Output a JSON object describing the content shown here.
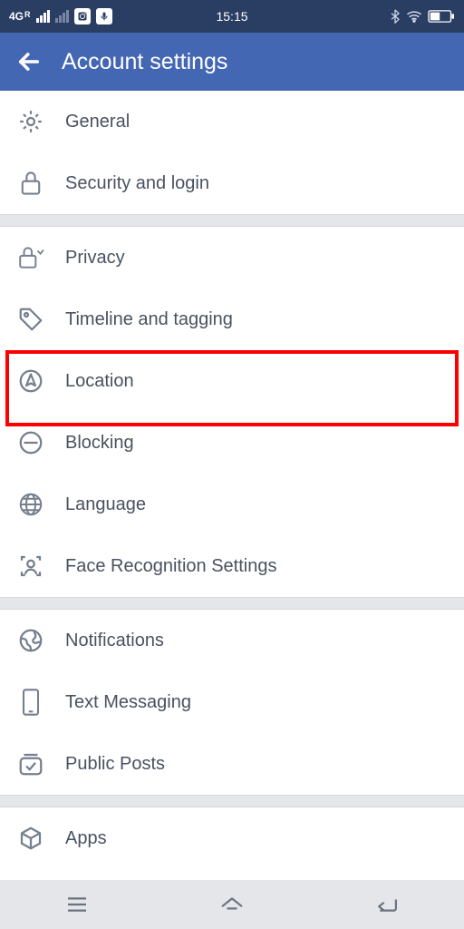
{
  "status": {
    "network_label": "4G",
    "network_sup": "R",
    "time": "15:15"
  },
  "header": {
    "title": "Account settings"
  },
  "sections": [
    {
      "items": [
        {
          "id": "general",
          "icon": "gear-icon",
          "label": "General"
        },
        {
          "id": "security",
          "icon": "lock-icon",
          "label": "Security and login"
        }
      ]
    },
    {
      "items": [
        {
          "id": "privacy",
          "icon": "privacy-lock-icon",
          "label": "Privacy"
        },
        {
          "id": "timeline",
          "icon": "tag-icon",
          "label": "Timeline and tagging"
        },
        {
          "id": "location",
          "icon": "location-icon",
          "label": "Location",
          "highlighted": true
        },
        {
          "id": "blocking",
          "icon": "blocking-icon",
          "label": "Blocking"
        },
        {
          "id": "language",
          "icon": "globe-icon",
          "label": "Language"
        },
        {
          "id": "facerec",
          "icon": "face-icon",
          "label": "Face Recognition Settings"
        }
      ]
    },
    {
      "items": [
        {
          "id": "notifications",
          "icon": "world-icon",
          "label": "Notifications"
        },
        {
          "id": "text",
          "icon": "phone-icon",
          "label": "Text Messaging"
        },
        {
          "id": "public",
          "icon": "posts-icon",
          "label": "Public Posts"
        }
      ]
    },
    {
      "items": [
        {
          "id": "apps",
          "icon": "cube-icon",
          "label": "Apps"
        }
      ]
    }
  ]
}
